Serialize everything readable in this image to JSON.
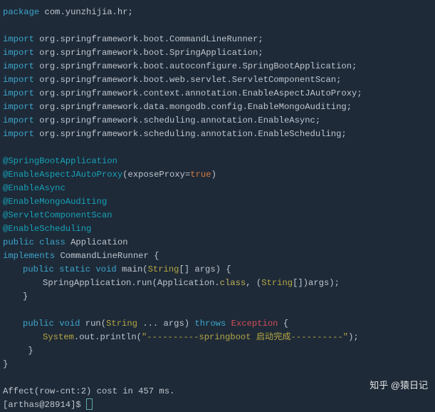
{
  "package_kw": "package",
  "package_name": " com.yunzhijia.hr;",
  "import_kw": "import",
  "imports": [
    " org.springframework.boot.CommandLineRunner;",
    " org.springframework.boot.SpringApplication;",
    " org.springframework.boot.autoconfigure.SpringBootApplication;",
    " org.springframework.boot.web.servlet.ServletComponentScan;",
    " org.springframework.context.annotation.EnableAspectJAutoProxy;",
    " org.springframework.data.mongodb.config.EnableMongoAuditing;",
    " org.springframework.scheduling.annotation.EnableAsync;",
    " org.springframework.scheduling.annotation.EnableScheduling;"
  ],
  "ann1": "@SpringBootApplication",
  "ann2_name": "@EnableAspectJAutoProxy",
  "ann2_paren_open": "(exposeProxy=",
  "ann2_true": "true",
  "ann2_paren_close": ")",
  "ann3": "@EnableAsync",
  "ann4": "@EnableMongoAuditing",
  "ann5": "@ServletComponentScan",
  "ann6": "@EnableScheduling",
  "public_kw": "public",
  "class_kw": "class",
  "app_name": " Application",
  "implements_kw": "implements",
  "impl_name": " CommandLineRunner {",
  "static_kw": "static",
  "void_kw": "void",
  "main_pre": " main(",
  "string_type": "String",
  "main_post": "[] args) {",
  "run_line_a": "SpringApplication.run(Application.",
  "class_literal": "class",
  "run_line_b": ", (",
  "run_line_c": "[])args);",
  "brace_close1": "}",
  "run_pre": " run(",
  "dots_args": " ... args) ",
  "throws_kw": "throws",
  "exception_type": "Exception",
  "open_brace": " {",
  "system_var": "System",
  "println_pre": ".out.println(",
  "string_literal": "\"----------springboot 启动完成----------\"",
  "println_post": ");",
  "brace_close2": " }",
  "brace_close3": "}",
  "affect_line": "Affect(row-cnt:2) cost in 457 ms.",
  "prompt": "[arthas@28914]$ ",
  "watermark": "知乎 @猿日记"
}
